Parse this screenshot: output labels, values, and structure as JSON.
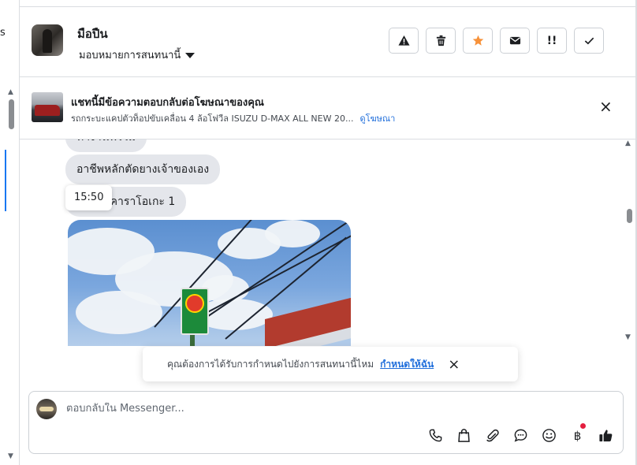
{
  "left_panel": {
    "text_fragment": "s"
  },
  "header": {
    "contact_name": "มือปืน",
    "assign_label": "มอบหมายการสนทนานี้",
    "action_buttons": [
      {
        "name": "warning-icon"
      },
      {
        "name": "trash-icon"
      },
      {
        "name": "star-icon",
        "color": "#f7923a"
      },
      {
        "name": "envelope-icon"
      },
      {
        "name": "follow-up-icon",
        "text": "!!"
      },
      {
        "name": "checkmark-icon"
      }
    ]
  },
  "ad_banner": {
    "title": "แชทนี้มีข้อความตอบกลับต่อโฆษณาของคุณ",
    "subtitle": "รถกระบะแคปตัวท็อปขับเคลื่อน 4 ล้อโฟวีล ISUZU D-MAX ALL NEW 20...",
    "link_label": "ดูโฆษณา",
    "close_label": "×"
  },
  "messages": [
    {
      "text": "ทำงานฟรีไม่"
    },
    {
      "text": "อาชีพหลักตัดยางเจ้าของเอง"
    },
    {
      "text": "ลูกชายคาราโอเกะ 1"
    }
  ],
  "tooltip": {
    "time": "15:50"
  },
  "reminder": {
    "text": "คุณต้องการได้รับการกำหนดไปยังการสนทนานี้ไหม",
    "link_label": "กำหนดให้ฉัน",
    "close_label": "×"
  },
  "composer": {
    "placeholder": "ตอบกลับใน Messenger...",
    "tools": [
      "phone-icon",
      "shopping-bag-icon",
      "paperclip-icon",
      "chat-bubble-icon",
      "emoji-icon",
      "baht-payment-icon",
      "thumbs-up-icon"
    ],
    "baht_symbol": "฿"
  },
  "colors": {
    "accent": "#216fdb",
    "star": "#f7923a",
    "bubble": "#e4e6eb",
    "notification_dot": "#e41e3f"
  }
}
